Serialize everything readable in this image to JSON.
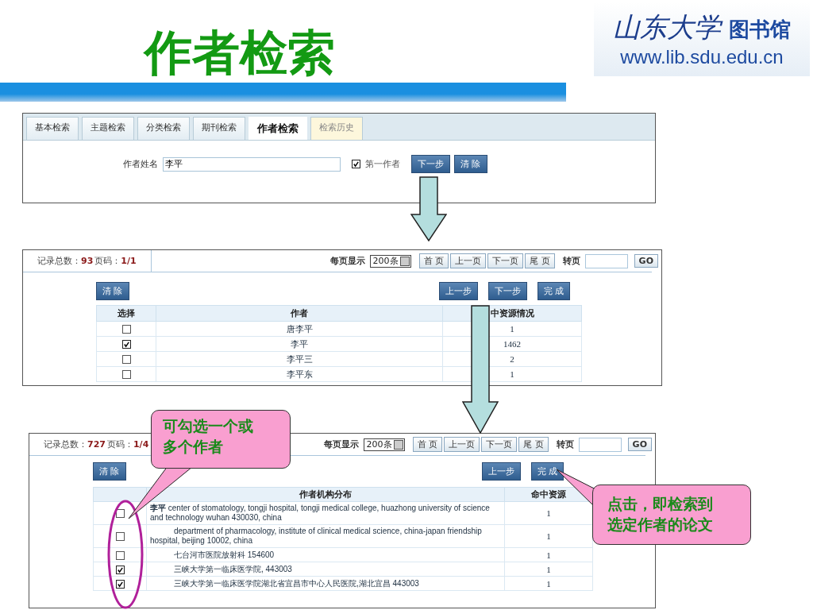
{
  "title": "作者检索",
  "logo": {
    "calligraphy": "山东大学",
    "name": "图书馆",
    "url": "www.lib.sdu.edu.cn"
  },
  "search_panel": {
    "tabs": [
      {
        "label": "基本检索",
        "selected": false
      },
      {
        "label": "主题检索",
        "selected": false
      },
      {
        "label": "分类检索",
        "selected": false
      },
      {
        "label": "期刊检索",
        "selected": false
      },
      {
        "label": "作者检索",
        "selected": true
      },
      {
        "label": "检索历史",
        "selected": false
      }
    ],
    "field_label": "作者姓名",
    "field_value": "李平",
    "first_author": {
      "label": "第一作者",
      "checked": true
    },
    "buttons": [
      "下一步",
      "清 除"
    ]
  },
  "author_panel": {
    "count_label": "记录总数：",
    "count": "93",
    "page_label": "页码：",
    "page": "1/1",
    "pager": {
      "per_page_label": "每页显示",
      "per_page": "200条",
      "buttons": [
        "首 页",
        "上一页",
        "下一页",
        "尾 页"
      ],
      "goto_label": "转页",
      "go": "GO"
    },
    "clear": "清 除",
    "steps": [
      "上一步",
      "下一步",
      "完 成"
    ],
    "columns": [
      "选择",
      "作者",
      "中资源情况"
    ],
    "rows": [
      {
        "checked": false,
        "author": "唐李平",
        "hits": "1"
      },
      {
        "checked": true,
        "author": "李平",
        "hits": "1462"
      },
      {
        "checked": false,
        "author": "李平三",
        "hits": "2"
      },
      {
        "checked": false,
        "author": "李平东",
        "hits": "1"
      }
    ]
  },
  "affiliation_panel": {
    "count_label": "记录总数：",
    "count": "727",
    "page_label": "页码：",
    "page": "1/4",
    "pager": {
      "per_page_label": "每页显示",
      "per_page": "200条",
      "buttons": [
        "首 页",
        "上一页",
        "下一页",
        "尾 页"
      ],
      "goto_label": "转页",
      "go": "GO"
    },
    "clear": "清 除",
    "steps": [
      "上一步",
      "完 成"
    ],
    "columns": [
      "作者机构分布",
      "命中资源"
    ],
    "rows": [
      {
        "checked": false,
        "author": "李平",
        "affiliation": "center of stomatology, tongji hospital, tongji medical college, huazhong university of science and technology wuhan 430030, china",
        "hits": "1"
      },
      {
        "checked": false,
        "affiliation": "department of pharmacology, institute of clinical medical science, china-japan friendship hospital, beijing 10002, china",
        "hits": "1"
      },
      {
        "checked": false,
        "affiliation": "七台河市医院放射科  154600",
        "hits": "1"
      },
      {
        "checked": true,
        "affiliation": "三峡大学第一临床医学院, 443003",
        "hits": "1"
      },
      {
        "checked": true,
        "affiliation": "三峡大学第一临床医学院湖北省宜昌市中心人民医院,湖北宜昌  443003",
        "hits": "1"
      }
    ]
  },
  "callouts": [
    "可勾选一个或多个作者",
    "点击，即检索到选定作者的论文"
  ]
}
